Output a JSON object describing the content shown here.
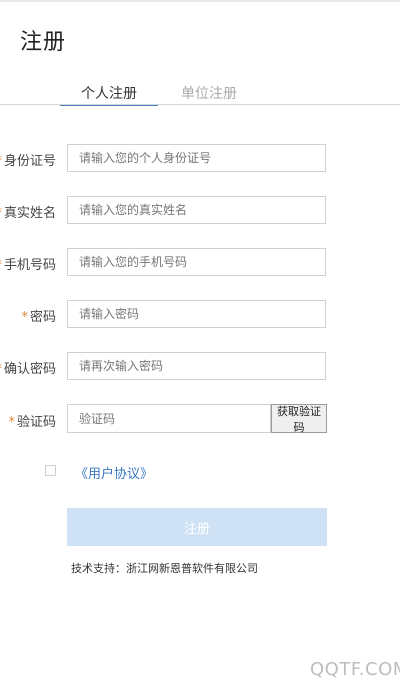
{
  "header": {
    "title": "注册"
  },
  "tabs": [
    {
      "label": "个人注册",
      "active": true
    },
    {
      "label": "单位注册",
      "active": false
    }
  ],
  "form": {
    "fields": [
      {
        "label": "身份证号",
        "required_mark": "*",
        "placeholder": "请输入您的个人身份证号"
      },
      {
        "label": "真实姓名",
        "required_mark": "*",
        "placeholder": "请输入您的真实姓名"
      },
      {
        "label": "手机号码",
        "required_mark": "*",
        "placeholder": "请输入您的手机号码"
      },
      {
        "label": "密码",
        "required_mark": "*",
        "placeholder": "请输入密码"
      },
      {
        "label": "确认密码",
        "required_mark": "*",
        "placeholder": "请再次输入密码"
      },
      {
        "label": "验证码",
        "required_mark": "*",
        "placeholder": "验证码"
      }
    ],
    "get_code_button": "获取验证码",
    "agreement_link": "《用户协议》",
    "submit_label": "注册"
  },
  "footer": {
    "support": "技术支持：浙江网新恩普软件有限公司"
  },
  "watermark": "QQTF.COM",
  "colors": {
    "accent": "#4a7fbe",
    "link": "#3a78c3",
    "required": "#e08a3a",
    "submit_bg": "#cfe2f5"
  }
}
